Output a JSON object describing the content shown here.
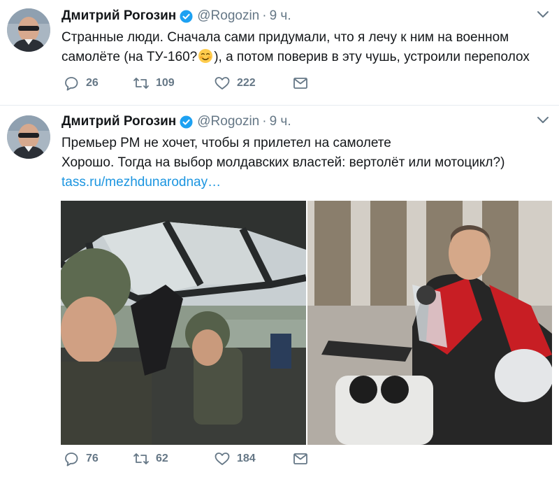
{
  "tweets": [
    {
      "author": {
        "name": "Дмитрий Рогозин",
        "handle": "@Rogozin",
        "time": "9 ч.",
        "verified": true
      },
      "text_line1": "Странные люди. Сначала сами придумали, что я лечу к ним на военном",
      "text_line2_a": "самолёте (на ТУ-160?",
      "text_line2_b": "), а потом поверив в эту чушь, устроили переполох",
      "emoji": "smiling-face-icon",
      "stats": {
        "replies": "26",
        "retweets": "109",
        "likes": "222"
      }
    },
    {
      "author": {
        "name": "Дмитрий Рогозин",
        "handle": "@Rogozin",
        "time": "9 ч.",
        "verified": true
      },
      "text_line1": "Премьер РМ не хочет, чтобы я прилетел на самолете",
      "text_line2": "Хорошо. Тогда на выбор молдавских властей: вертолёт или мотоцикл?)",
      "link": "tass.ru/mezhdunarodnay…",
      "stats": {
        "replies": "76",
        "retweets": "62",
        "likes": "184"
      }
    }
  ],
  "colors": {
    "verified": "#1da1f2",
    "link": "#1b95e0",
    "muted": "#657786"
  },
  "dot": "·"
}
